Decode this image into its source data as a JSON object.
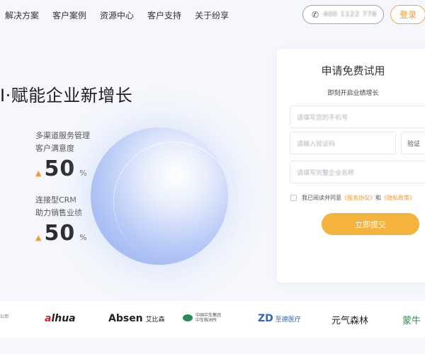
{
  "nav": {
    "items": [
      "解决方案",
      "客户案例",
      "资源中心",
      "客户支持",
      "关于纷享"
    ],
    "phone_number": "400 1122 778",
    "login_label": "登录"
  },
  "hero": {
    "title": "I·赋能企业新增长",
    "stats": [
      {
        "label_line1": "多渠道服务管理",
        "label_line2": "客户满意度",
        "value": "50",
        "unit": "%"
      },
      {
        "label_line1": "连接型CRM",
        "label_line2": "助力销售业绩",
        "value": "50",
        "unit": "%"
      }
    ]
  },
  "form": {
    "title": "申请免费试用",
    "subtitle": "即刻开启业绩增长",
    "phone_placeholder": "请填写您的手机号",
    "code_placeholder": "请输入验证码",
    "code_button": "验证",
    "company_placeholder": "请填写完整企业名称",
    "agree_prefix": "我已阅读并同意",
    "agree_link1": "《服务协议》",
    "agree_and": "和",
    "agree_link2": "《隐私政策》",
    "submit_label": "立即提交"
  },
  "logos": {
    "cut_text": "公司",
    "dahua_a": "a",
    "dahua_rest": "lhua",
    "absen": "Absen",
    "absen_cn": "艾比森",
    "cdr_line1": "中国中车集团",
    "cdr_line2": "中车株洲所",
    "zd_mark": "ZD",
    "zd_text": "至德医疗",
    "yqsl": "元气森林",
    "mn": "蒙牛"
  },
  "colors": {
    "accent": "#f3b33d",
    "login_border": "#f0a640",
    "link": "#e99a32"
  }
}
